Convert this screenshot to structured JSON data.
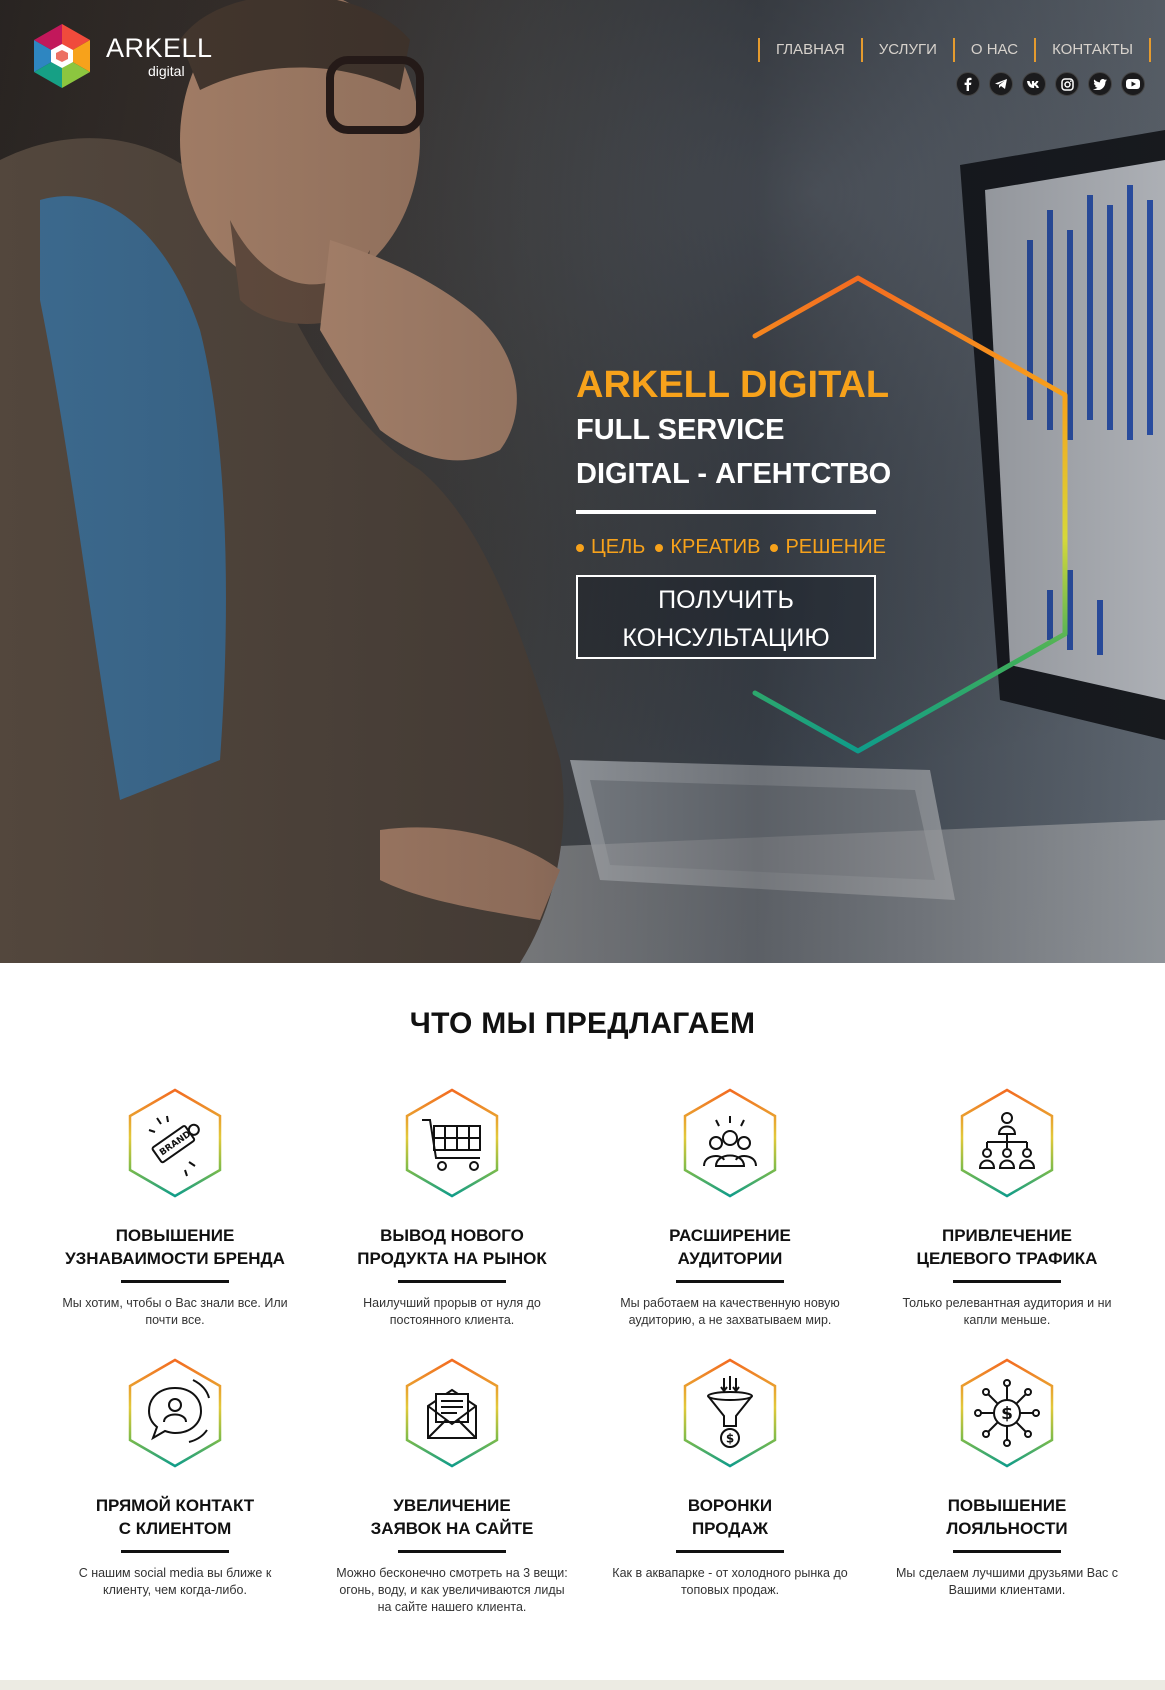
{
  "logo": {
    "name": "ARKELL",
    "sub": "digital",
    "icon": "hexagon-cube-logo"
  },
  "nav": {
    "items": [
      {
        "label": "ГЛАВНАЯ"
      },
      {
        "label": "УСЛУГИ"
      },
      {
        "label": "О НАС"
      },
      {
        "label": "КОНТАКТЫ"
      }
    ]
  },
  "social": [
    "facebook-icon",
    "telegram-icon",
    "vk-icon",
    "instagram-icon",
    "twitter-icon",
    "youtube-icon"
  ],
  "hero": {
    "brand": "ARKELL DIGITAL",
    "line1": "FULL SERVICE",
    "line2": "DIGITAL - АГЕНТСТВО",
    "tags": [
      "ЦЕЛЬ",
      "КРЕАТИВ",
      "РЕШЕНИЕ"
    ],
    "cta_line1": "ПОЛУЧИТЬ",
    "cta_line2": "КОНСУЛЬТАЦИЮ"
  },
  "services": {
    "title": "ЧТО МЫ ПРЕДЛАГАЕМ",
    "items": [
      {
        "icon": "brand-tag-icon",
        "title": "ПОВЫШЕНИЕ\nУЗНАВАИМОСТИ БРЕНДА",
        "text": "Мы хотим, чтобы о Вас знали все. Или почти все."
      },
      {
        "icon": "shopping-cart-icon",
        "title": "ВЫВОД НОВОГО\nПРОДУКТА НА РЫНОК",
        "text": "Наилучший прорыв от нуля до постоянного клиента."
      },
      {
        "icon": "audience-group-icon",
        "title": "РАСШИРЕНИЕ\nАУДИТОРИИ",
        "text": "Мы работаем на качественную новую аудиторию, а не захватываем мир."
      },
      {
        "icon": "org-hierarchy-icon",
        "title": "ПРИВЛЕЧЕНИЕ\nЦЕЛЕВОГО ТРАФИКА",
        "text": "Только релевантная аудитория и ни капли меньше."
      },
      {
        "icon": "chat-person-icon",
        "title": "ПРЯМОЙ КОНТАКТ\nС КЛИЕНТОМ",
        "text": "С нашим social media вы ближе к клиенту, чем когда-либо."
      },
      {
        "icon": "envelope-letter-icon",
        "title": "УВЕЛИЧЕНИЕ\nЗАЯВОК НА САЙТЕ",
        "text": "Можно бесконечно смотреть на 3 вещи: огонь, воду, и как увеличиваются лиды на сайте нашего клиента."
      },
      {
        "icon": "sales-funnel-icon",
        "title": "ВОРОНКИ\nПРОДАЖ",
        "text": "Как в аквапарке - от холодного рынка до топовых продаж."
      },
      {
        "icon": "dollar-network-icon",
        "title": "ПОВЫШЕНИЕ\nЛОЯЛЬНОСТИ",
        "text": "Мы сделаем лучшими друзьями Вас с Вашими клиентами."
      }
    ]
  },
  "colors": {
    "accent": "#f7a21b",
    "gradient_top": "#f36b21",
    "gradient_mid": "#d6d83a",
    "gradient_bottom": "#0f9c8a"
  }
}
